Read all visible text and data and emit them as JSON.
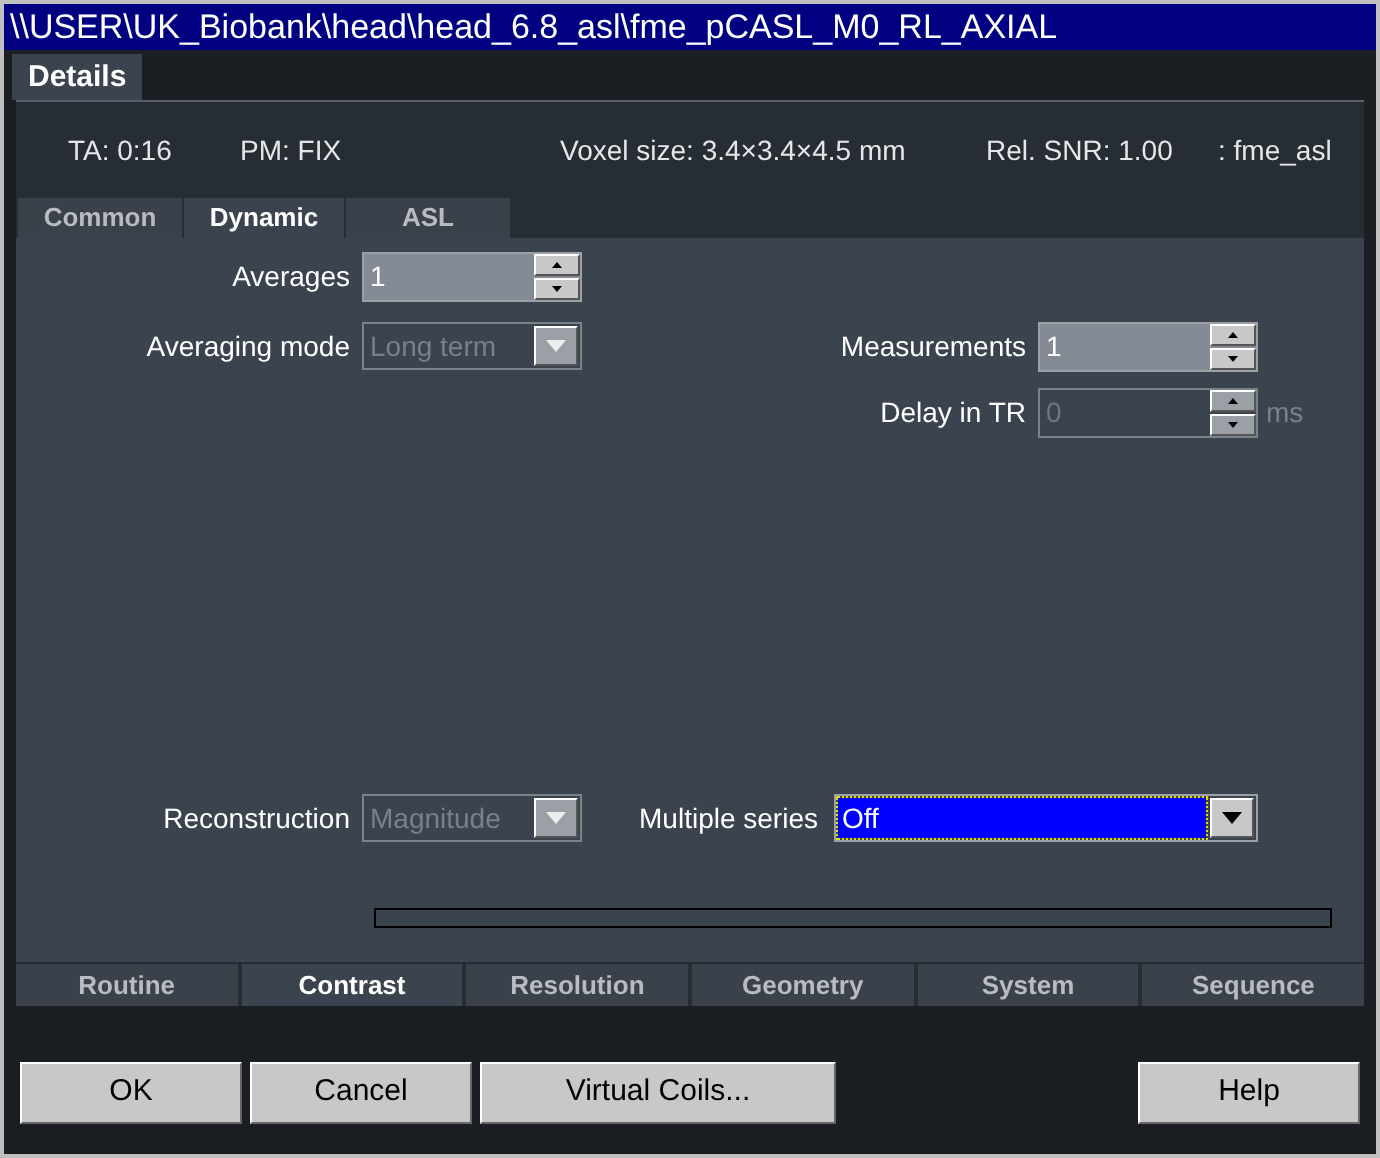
{
  "window": {
    "title": "\\\\USER\\UK_Biobank\\head\\head_6.8_asl\\fme_pCASL_M0_RL_AXIAL"
  },
  "top_tabs": [
    {
      "label": "Details",
      "selected": true
    }
  ],
  "info": [
    "TA: 0:16",
    "PM: FIX",
    "Voxel size: 3.4×3.4×4.5 mm",
    "Rel. SNR: 1.00",
    ": fme_asl"
  ],
  "sub_tabs": [
    {
      "label": "Common",
      "selected": false
    },
    {
      "label": "Dynamic",
      "selected": true
    },
    {
      "label": "ASL",
      "selected": false
    }
  ],
  "fields": [
    {
      "label": "Averages",
      "kind": "spinner",
      "value": "1",
      "disabled": false
    },
    {
      "label": "Averaging mode",
      "kind": "dropdown",
      "value": "Long term",
      "disabled": true
    },
    {
      "label": "Measurements",
      "kind": "spinner",
      "value": "1",
      "disabled": false
    },
    {
      "label": "Delay in TR",
      "kind": "spinner",
      "value": "0",
      "disabled": true,
      "unit": "ms"
    },
    {
      "label": "Reconstruction",
      "kind": "dropdown",
      "value": "Magnitude",
      "disabled": true
    },
    {
      "label": "Multiple series",
      "kind": "dropdown",
      "value": "Off",
      "disabled": false,
      "focused": true
    }
  ],
  "progress": {
    "level": 0
  },
  "bottom_tabs": [
    {
      "label": "Routine",
      "selected": false
    },
    {
      "label": "Contrast",
      "selected": true
    },
    {
      "label": "Resolution",
      "selected": false
    },
    {
      "label": "Geometry",
      "selected": false
    },
    {
      "label": "System",
      "selected": false
    },
    {
      "label": "Sequence",
      "selected": false
    }
  ],
  "buttons": [
    {
      "label": "OK"
    },
    {
      "label": "Cancel"
    },
    {
      "label": "Virtual Coils..."
    },
    {
      "label": "Help"
    }
  ]
}
